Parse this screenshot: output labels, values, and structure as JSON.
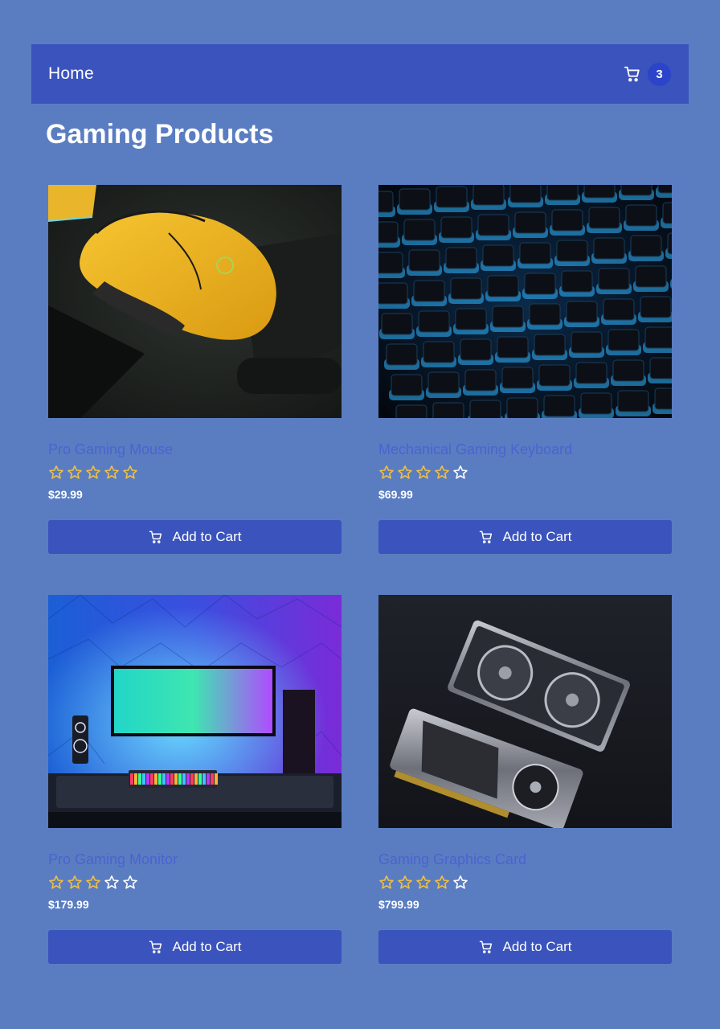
{
  "navbar": {
    "home_label": "Home",
    "cart_icon": "cart-icon",
    "cart_count": "3",
    "bg_color": "#3a53bd",
    "badge_color": "#2b44c9"
  },
  "page": {
    "title": "Gaming Products",
    "bg_color": "#5a7dc2"
  },
  "products": [
    {
      "name": "Pro Gaming Mouse",
      "rating": 5,
      "max_rating": 5,
      "price": "$29.99",
      "button_label": "Add to Cart",
      "image": "yellow gaming mouse"
    },
    {
      "name": "Mechanical Gaming Keyboard",
      "rating": 4,
      "max_rating": 5,
      "price": "$69.99",
      "button_label": "Add to Cart",
      "image": "backlit mechanical keyboard"
    },
    {
      "name": "Pro Gaming Monitor",
      "rating": 3,
      "max_rating": 5,
      "price": "$179.99",
      "button_label": "Add to Cart",
      "image": "gaming desk setup with monitor"
    },
    {
      "name": "Gaming Graphics Card",
      "rating": 4,
      "max_rating": 5,
      "price": "$799.99",
      "button_label": "Add to Cart",
      "image": "two graphics cards"
    }
  ],
  "colors": {
    "star_filled": "#f0c040",
    "star_empty": "#ffffff",
    "product_name": "#4a63cf",
    "button": "#3a53bd"
  }
}
